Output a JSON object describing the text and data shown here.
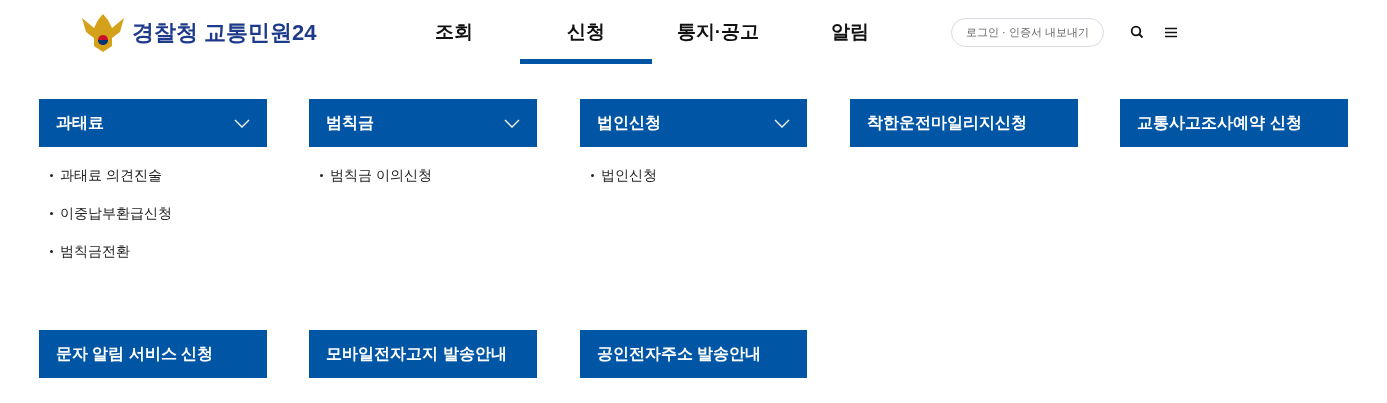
{
  "header": {
    "logo": "경찰청 교통민원24",
    "nav": [
      {
        "label": "조회",
        "selected": false
      },
      {
        "label": "신청",
        "selected": true
      },
      {
        "label": "통지·공고",
        "selected": false
      },
      {
        "label": "알림",
        "selected": false
      }
    ],
    "login_button": "로그인 · 인증서 내보내기"
  },
  "sections": [
    {
      "title": "과태료",
      "kind": "dropdown",
      "items": [
        "과태료 의견진술",
        "이중납부환급신청",
        "범칙금전환"
      ]
    },
    {
      "title": "범칙금",
      "kind": "dropdown",
      "items": [
        "범칙금 이의신청"
      ]
    },
    {
      "title": "법인신청",
      "kind": "dropdown",
      "items": [
        "법인신청"
      ]
    },
    {
      "title": "착한운전마일리지신청",
      "kind": "link"
    },
    {
      "title": "교통사고조사예약 신청",
      "kind": "link"
    },
    {
      "title": "문자 알림 서비스 신청",
      "kind": "link"
    },
    {
      "title": "모바일전자고지 발송안내",
      "kind": "link"
    },
    {
      "title": "공인전자주소 발송안내",
      "kind": "link"
    }
  ]
}
